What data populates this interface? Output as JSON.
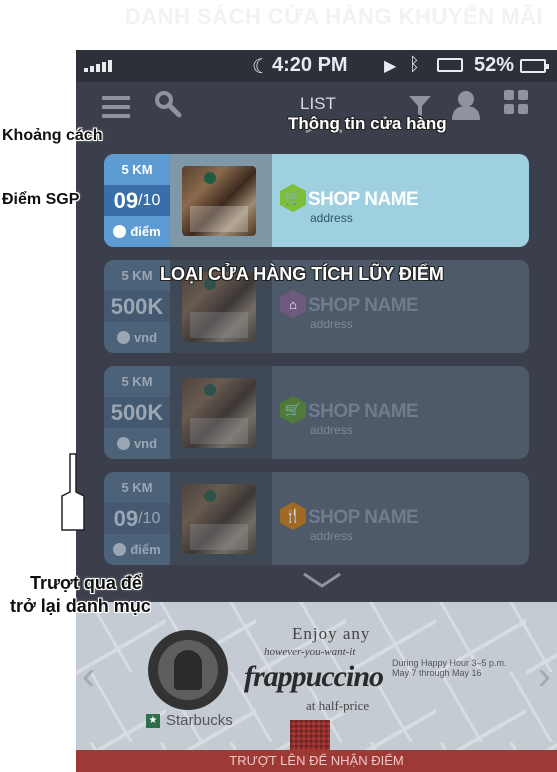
{
  "page_header": "DANH SÁCH CỬA HÀNG KHUYẾN MÃI",
  "status_bar": {
    "time": "4:20 PM",
    "battery": "52%"
  },
  "toolbar": {
    "list_label": "LIST"
  },
  "annotations": {
    "distance": "Khoảng cách",
    "sgp_points": "Điểm SGP",
    "store_info": "Thông tin cửa hàng",
    "store_type": "LOẠI CỬA HÀNG TÍCH LŨY ĐIỂM",
    "swipe_back_line1": "Trượt qua để",
    "swipe_back_line2": "trở lại danh mục"
  },
  "shops": [
    {
      "distance": "5 KM",
      "score": "09",
      "score_denominator": "/10",
      "unit": "điểm",
      "name": "SHOP NAME",
      "address": "address",
      "type_icon": "cart-icon",
      "type_color": "#7bbf3a",
      "active": true
    },
    {
      "distance": "5 KM",
      "score": "500K",
      "score_denominator": "",
      "unit": "vnd",
      "name": "SHOP NAME",
      "address": "address",
      "type_icon": "hanger-icon",
      "type_color": "#8a6a9a",
      "active": false
    },
    {
      "distance": "5 KM",
      "score": "500K",
      "score_denominator": "",
      "unit": "vnd",
      "name": "SHOP NAME",
      "address": "address",
      "type_icon": "cart-icon",
      "type_color": "#5a8a3a",
      "active": false
    },
    {
      "distance": "5 KM",
      "score": "09",
      "score_denominator": "/10",
      "unit": "điểm",
      "name": "SHOP NAME",
      "address": "address",
      "type_icon": "fork-knife-icon",
      "type_color": "#b57a2a",
      "active": false
    }
  ],
  "banner": {
    "enjoy": "Enjoy any",
    "tagline": "however-you-want-it",
    "product": "frappuccino",
    "price_note": "at half-price",
    "promo_line1": "During Happy Hour 3–5 p.m.",
    "promo_line2": "May 7 through May 16",
    "brand": "Starbucks",
    "cta": "TRƯỢT LÊN ĐỂ NHẬN ĐIỂM"
  },
  "colors": {
    "active_card": "#9fd0e0",
    "active_metric": "#5d9cd2",
    "dim_card": "#4e5a69",
    "background": "#3a3f4b"
  }
}
